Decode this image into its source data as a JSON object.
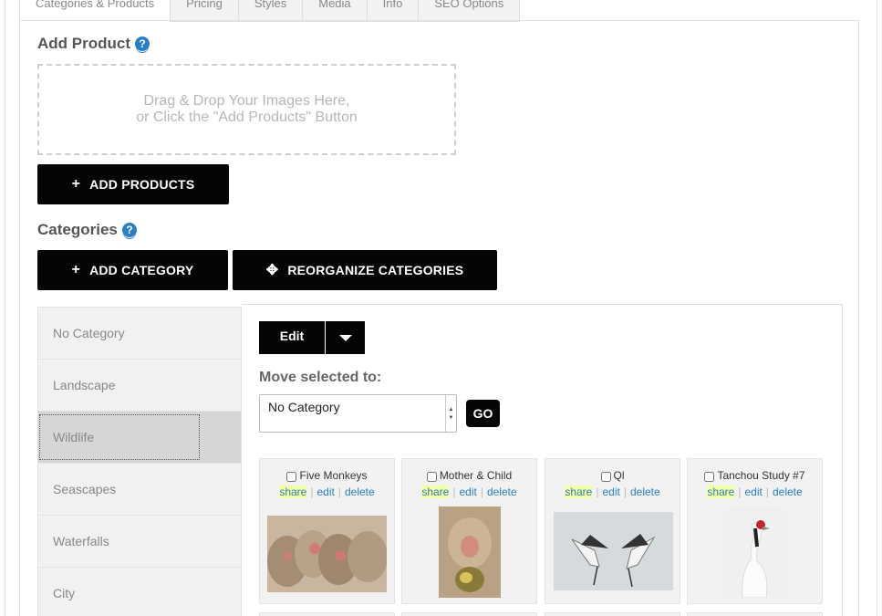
{
  "tabs": [
    "Categories & Products",
    "Pricing",
    "Styles",
    "Media",
    "Info",
    "SEO Options"
  ],
  "add_product": {
    "title": "Add Product",
    "dropzone_line1": "Drag & Drop Your Images Here,",
    "dropzone_line2": "or Click the \"Add Products\" Button",
    "button": "ADD PRODUCTS"
  },
  "categories": {
    "title": "Categories",
    "add_button": "ADD CATEGORY",
    "reorganize_button": "REORGANIZE CATEGORIES",
    "items": [
      "No Category",
      "Landscape",
      "Wildlife",
      "Seascapes",
      "Waterfalls",
      "City"
    ],
    "active": "Wildlife"
  },
  "toolbar": {
    "edit_label": "Edit",
    "move_label": "Move selected to:",
    "move_selected": "No Category",
    "go_label": "GO"
  },
  "products": [
    {
      "name": "Five Monkeys",
      "share": "share",
      "edit": "edit",
      "delete": "delete"
    },
    {
      "name": "Mother & Child",
      "share": "share",
      "edit": "edit",
      "delete": "delete"
    },
    {
      "name": "Ql",
      "share": "share",
      "edit": "edit",
      "delete": "delete"
    },
    {
      "name": "Tanchou Study #7",
      "share": "share",
      "edit": "edit",
      "delete": "delete"
    }
  ],
  "icons": {
    "help": "?",
    "plus": "+",
    "move": "✥"
  },
  "colors": {
    "button_bg": "#050505",
    "link": "#2a7fc4",
    "share_highlight": "#f5ffa3",
    "active_category": "#d6d6d6"
  }
}
